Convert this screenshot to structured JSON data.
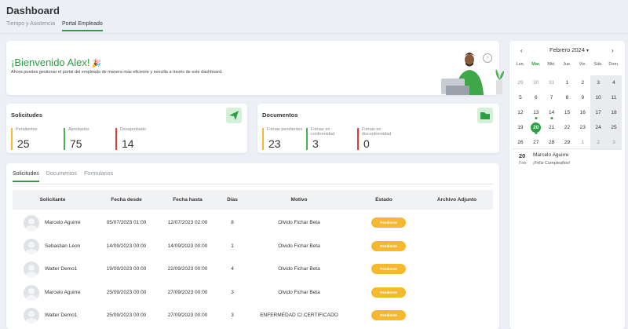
{
  "header": {
    "title": "Dashboard",
    "tabs": [
      "Tiempo y Asistencia",
      "Portal Empleado"
    ],
    "active_tab": 1
  },
  "welcome": {
    "title": "¡Bienvenido Alex!",
    "emoji": "🎉",
    "subtitle": "Ahora puedes gestionar el portal del empleado de manera más eficiente y sencilla a través de este dashboard."
  },
  "solicitudes": {
    "title": "Solicitudes",
    "icon": "send-icon",
    "metrics": [
      {
        "label": "Pendientes",
        "value": "25",
        "color": "#f5b82e"
      },
      {
        "label": "Aprobados",
        "value": "75",
        "color": "#4caf50"
      },
      {
        "label": "Desaprobado",
        "value": "14",
        "color": "#e53935"
      }
    ]
  },
  "documentos": {
    "title": "Documentos",
    "icon": "folder-icon",
    "metrics": [
      {
        "label": "Firmas pendientes",
        "value": "23",
        "color": "#f5b82e"
      },
      {
        "label": "Firmas en conformidad",
        "value": "3",
        "color": "#4caf50"
      },
      {
        "label": "Firmas en disconformidad",
        "value": "0",
        "color": "#e53935"
      }
    ]
  },
  "requests": {
    "tabs": [
      "Solicitudes",
      "Documentos",
      "Formularios"
    ],
    "active_tab": 0,
    "columns": [
      "Solicitante",
      "Fecha desde",
      "Fecha hasta",
      "Días",
      "Motivo",
      "Estado",
      "Archivo Adjunto"
    ],
    "rows": [
      {
        "name": "Marcelo Aguirre",
        "from": "05/07/2023 01:00",
        "to": "12/07/2023 02:00",
        "days": "8",
        "reason": "Olvido Fichar Beta",
        "status": "Pendiente"
      },
      {
        "name": "Sebastian Leon",
        "from": "14/09/2023 00:00",
        "to": "14/09/2023 00:00",
        "days": "1",
        "reason": "Olvido Fichar Beta",
        "status": "Pendiente"
      },
      {
        "name": "Walter Demo1",
        "from": "19/09/2023 00:00",
        "to": "22/09/2023 00:00",
        "days": "4",
        "reason": "Olvido Fichar Beta",
        "status": "Pendiente"
      },
      {
        "name": "Marcelo Aguirre",
        "from": "25/09/2023 00:00",
        "to": "27/09/2023 00:00",
        "days": "3",
        "reason": "Olvido Fichar Beta",
        "status": "Pendiente"
      },
      {
        "name": "Walter Demo1",
        "from": "25/09/2023 00:00",
        "to": "27/09/2023 00:00",
        "days": "3",
        "reason": "ENFERMEDAD C/ CERTIFICADO",
        "status": "Pendiente"
      }
    ]
  },
  "calendar": {
    "month": "Febrero 2024",
    "prev": "‹",
    "next": "›",
    "dropdown": "▾",
    "weekdays": [
      "Lun.",
      "Mar.",
      "Mié.",
      "Jue.",
      "Vie.",
      "Sáb.",
      "Dom."
    ],
    "weeks": [
      [
        "29",
        "30",
        "31",
        "1",
        "2",
        "3",
        "4"
      ],
      [
        "5",
        "6",
        "7",
        "8",
        "9",
        "10",
        "11"
      ],
      [
        "12",
        "13",
        "14",
        "15",
        "16",
        "17",
        "18"
      ],
      [
        "19",
        "20",
        "21",
        "22",
        "23",
        "24",
        "25"
      ],
      [
        "26",
        "27",
        "28",
        "29",
        "1",
        "2",
        "3"
      ]
    ],
    "event": {
      "day": "20",
      "month": "Feb",
      "name": "Marcelo Aguirre",
      "text": "¡Feliz Cumpleaños!"
    }
  }
}
